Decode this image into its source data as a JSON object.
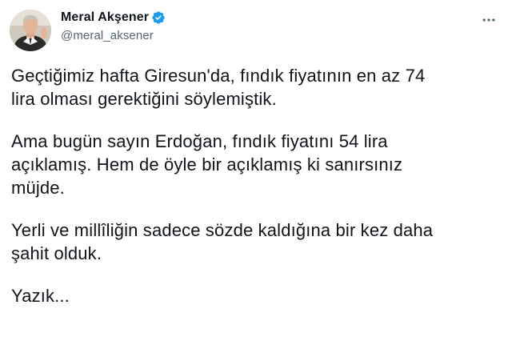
{
  "author": {
    "display_name": "Meral Akşener",
    "handle": "@meral_aksener",
    "verified": true
  },
  "icons": {
    "verified": "verified-badge-icon",
    "more": "more-horizontal-icon"
  },
  "colors": {
    "verified_blue": "#1d9bf0",
    "text_primary": "#0f1419",
    "text_secondary": "#536471"
  },
  "tweet": {
    "paragraphs": [
      {
        "lines": [
          "Geçtiğimiz hafta Giresun'da, fındık fiyatının en az 74",
          "lira olması gerektiğini söylemiştik."
        ]
      },
      {
        "lines": [
          "Ama bugün sayın Erdoğan, fındık fiyatını 54 lira",
          "açıklamış. Hem de öyle bir açıklamış ki sanırsınız",
          "müjde."
        ]
      },
      {
        "lines": [
          "Yerli ve millîliğin sadece sözde kaldığına bir kez daha",
          "şahit olduk."
        ]
      },
      {
        "lines": [
          "Yazık..."
        ]
      }
    ]
  }
}
